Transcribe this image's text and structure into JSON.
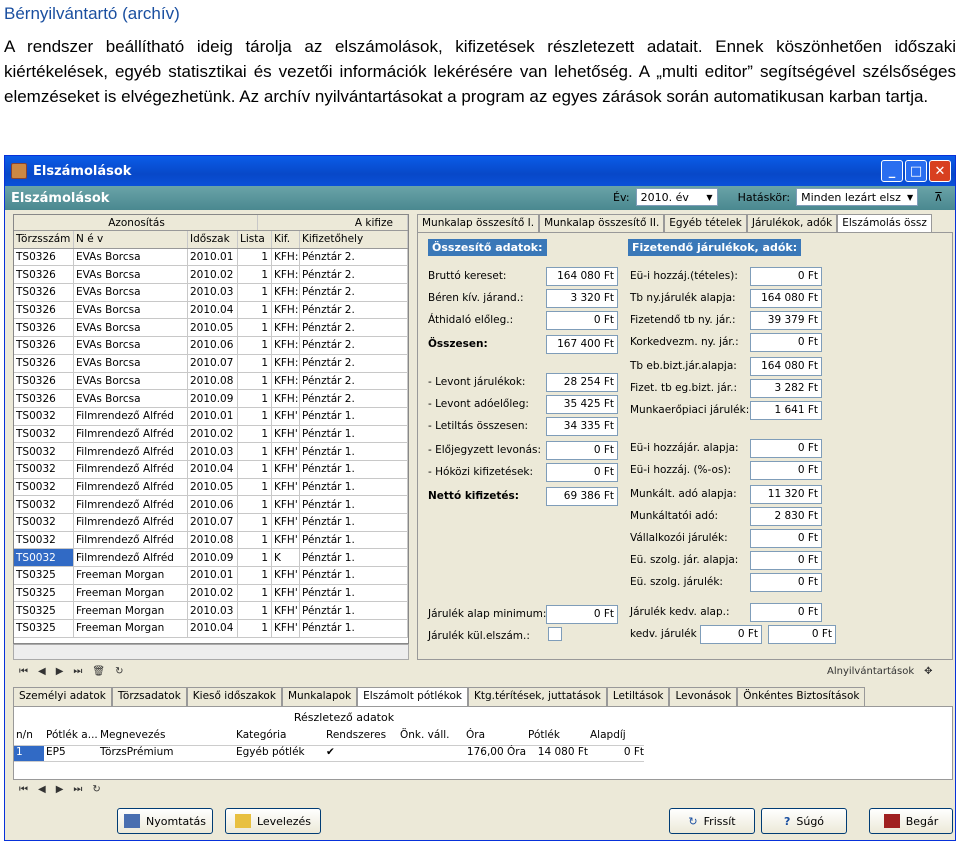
{
  "doc": {
    "title": "Bérnyilvántartó (archív)",
    "paragraph": "A rendszer beállítható ideig tárolja az elszámolások, kifizetések részletezett adatait. Ennek köszönhetően időszaki kiértékelések, egyéb statisztikai és vezetői információk lekérésére van lehetőség. A „multi editor” segítségével szélsőséges elemzéseket is elvégezhetünk. Az archív nyilvántartásokat a program az egyes zárások során automatikusan karban tartja."
  },
  "window": {
    "title": "Elszámolások",
    "form_title": "Elszámolások",
    "ev_label": "Év:",
    "ev_value": "2010. év",
    "hatasker_label": "Hatáskör:",
    "hatasker_value": "Minden lezárt elszám"
  },
  "grid": {
    "group_headers": [
      "Azonosítás",
      "A kifize"
    ],
    "columns": [
      "Törzsszám",
      "N é v",
      "Időszak",
      "Lista",
      "Kif.",
      "Kifizetőhely"
    ],
    "rows": [
      [
        "TS0326",
        "EVAs Borcsa",
        "2010.01",
        "1",
        "KFH:",
        "Pénztár 2."
      ],
      [
        "TS0326",
        "EVAs Borcsa",
        "2010.02",
        "1",
        "KFH:",
        "Pénztár 2."
      ],
      [
        "TS0326",
        "EVAs Borcsa",
        "2010.03",
        "1",
        "KFH:",
        "Pénztár 2."
      ],
      [
        "TS0326",
        "EVAs Borcsa",
        "2010.04",
        "1",
        "KFH:",
        "Pénztár 2."
      ],
      [
        "TS0326",
        "EVAs Borcsa",
        "2010.05",
        "1",
        "KFH:",
        "Pénztár 2."
      ],
      [
        "TS0326",
        "EVAs Borcsa",
        "2010.06",
        "1",
        "KFH:",
        "Pénztár 2."
      ],
      [
        "TS0326",
        "EVAs Borcsa",
        "2010.07",
        "1",
        "KFH:",
        "Pénztár 2."
      ],
      [
        "TS0326",
        "EVAs Borcsa",
        "2010.08",
        "1",
        "KFH:",
        "Pénztár 2."
      ],
      [
        "TS0326",
        "EVAs Borcsa",
        "2010.09",
        "1",
        "KFH:",
        "Pénztár 2."
      ],
      [
        "TS0032",
        "Filmrendező Alfréd",
        "2010.01",
        "1",
        "KFH'",
        "Pénztár 1."
      ],
      [
        "TS0032",
        "Filmrendező Alfréd",
        "2010.02",
        "1",
        "KFH'",
        "Pénztár 1."
      ],
      [
        "TS0032",
        "Filmrendező Alfréd",
        "2010.03",
        "1",
        "KFH'",
        "Pénztár 1."
      ],
      [
        "TS0032",
        "Filmrendező Alfréd",
        "2010.04",
        "1",
        "KFH'",
        "Pénztár 1."
      ],
      [
        "TS0032",
        "Filmrendező Alfréd",
        "2010.05",
        "1",
        "KFH'",
        "Pénztár 1."
      ],
      [
        "TS0032",
        "Filmrendező Alfréd",
        "2010.06",
        "1",
        "KFH'",
        "Pénztár 1."
      ],
      [
        "TS0032",
        "Filmrendező Alfréd",
        "2010.07",
        "1",
        "KFH'",
        "Pénztár 1."
      ],
      [
        "TS0032",
        "Filmrendező Alfréd",
        "2010.08",
        "1",
        "KFH'",
        "Pénztár 1."
      ],
      [
        "TS0032",
        "Filmrendező Alfréd",
        "2010.09",
        "1",
        "K",
        "Pénztár 1."
      ],
      [
        "TS0325",
        "Freeman Morgan",
        "2010.01",
        "1",
        "KFH'",
        "Pénztár 1."
      ],
      [
        "TS0325",
        "Freeman Morgan",
        "2010.02",
        "1",
        "KFH'",
        "Pénztár 1."
      ],
      [
        "TS0325",
        "Freeman Morgan",
        "2010.03",
        "1",
        "KFH'",
        "Pénztár 1."
      ],
      [
        "TS0325",
        "Freeman Morgan",
        "2010.04",
        "1",
        "KFH'",
        "Pénztár 1."
      ]
    ]
  },
  "right_tabs": [
    "Munkalap összesítő I.",
    "Munkalap összesítő II.",
    "Egyéb tételek",
    "Járulékok, adók",
    "Elszámolás össz"
  ],
  "osszesito": {
    "header": "Összesítő adatok:",
    "fields": [
      {
        "label": "Bruttó kereset:",
        "value": "164 080 Ft"
      },
      {
        "label": "Béren kív. járand.:",
        "value": "3 320 Ft"
      },
      {
        "label": "Áthidaló előleg.:",
        "value": "0 Ft"
      },
      {
        "label": "Összesen:",
        "value": "167 400 Ft"
      },
      {
        "label": "- Levont járulékok:",
        "value": "28 254 Ft"
      },
      {
        "label": "- Levont adóelőleg:",
        "value": "35 425 Ft"
      },
      {
        "label": "- Letiltás összesen:",
        "value": "34 335 Ft"
      },
      {
        "label": "- Előjegyzett levonás:",
        "value": "0 Ft"
      },
      {
        "label": "- Hóközi kifizetések:",
        "value": "0 Ft"
      },
      {
        "label": "Nettó kifizetés:",
        "value": "69 386 Ft"
      },
      {
        "label": "Járulék alap minimum:",
        "value": "0 Ft"
      },
      {
        "label": "Járulék kül.elszám.:",
        "value": ""
      }
    ]
  },
  "fizetendo": {
    "header": "Fizetendő járulékok, adók:",
    "fields": [
      {
        "label": "Eü-i hozzáj.(tételes):",
        "value": "0 Ft"
      },
      {
        "label": "Tb ny.járulék alapja:",
        "value": "164 080 Ft"
      },
      {
        "label": "Fizetendő tb ny. jár.:",
        "value": "39 379 Ft"
      },
      {
        "label": "Korkedvezm. ny. jár.:",
        "value": "0 Ft"
      },
      {
        "label": "Tb eb.bizt.jár.alapja:",
        "value": "164 080 Ft"
      },
      {
        "label": "Fizet. tb eg.bizt. jár.:",
        "value": "3 282 Ft"
      },
      {
        "label": "Munkaerőpiaci járulék:",
        "value": "1 641 Ft"
      },
      {
        "label": "Eü-i hozzájár. alapja:",
        "value": "0 Ft"
      },
      {
        "label": "Eü-i hozzáj. (%-os):",
        "value": "0 Ft"
      },
      {
        "label": "Munkált. adó alapja:",
        "value": "11 320 Ft"
      },
      {
        "label": "Munkáltatói adó:",
        "value": "2 830 Ft"
      },
      {
        "label": "Vállalkozói járulék:",
        "value": "0 Ft"
      },
      {
        "label": "Eü. szolg. jár. alapja:",
        "value": "0 Ft"
      },
      {
        "label": "Eü. szolg. járulék:",
        "value": "0 Ft"
      },
      {
        "label": "Járulék kedv. alap.:",
        "value": "0 Ft"
      },
      {
        "label": "kedv. járulék",
        "value": "0 Ft"
      },
      {
        "label": "",
        "value": "0 Ft"
      }
    ]
  },
  "nav_right_label": "Alnyilvántartások",
  "bottom_tabs": [
    "Személyi adatok",
    "Törzsadatok",
    "Kieső időszakok",
    "Munkalapok",
    "Elszámolt pótlékok",
    "Ktg.térítések, juttatások",
    "Letiltások",
    "Levonások",
    "Önkéntes Biztosítások"
  ],
  "detail": {
    "group_header": "Részletező adatok",
    "columns": [
      "n/n",
      "Pótlék a...",
      "Megnevezés",
      "Kategória",
      "Rendszeres",
      "Önk. váll.",
      "Óra",
      "Pótlék",
      "Alapdíj"
    ],
    "row": [
      "1",
      "EP5",
      "TörzsPrémium",
      "Egyéb pótlék",
      "✔",
      "",
      "176,00 Óra",
      "14 080 Ft",
      "0 Ft"
    ]
  },
  "footer": {
    "print": "Nyomtatás",
    "mail": "Levelezés",
    "refresh": "Frissít",
    "help": "Súgó",
    "close": "Begár"
  }
}
